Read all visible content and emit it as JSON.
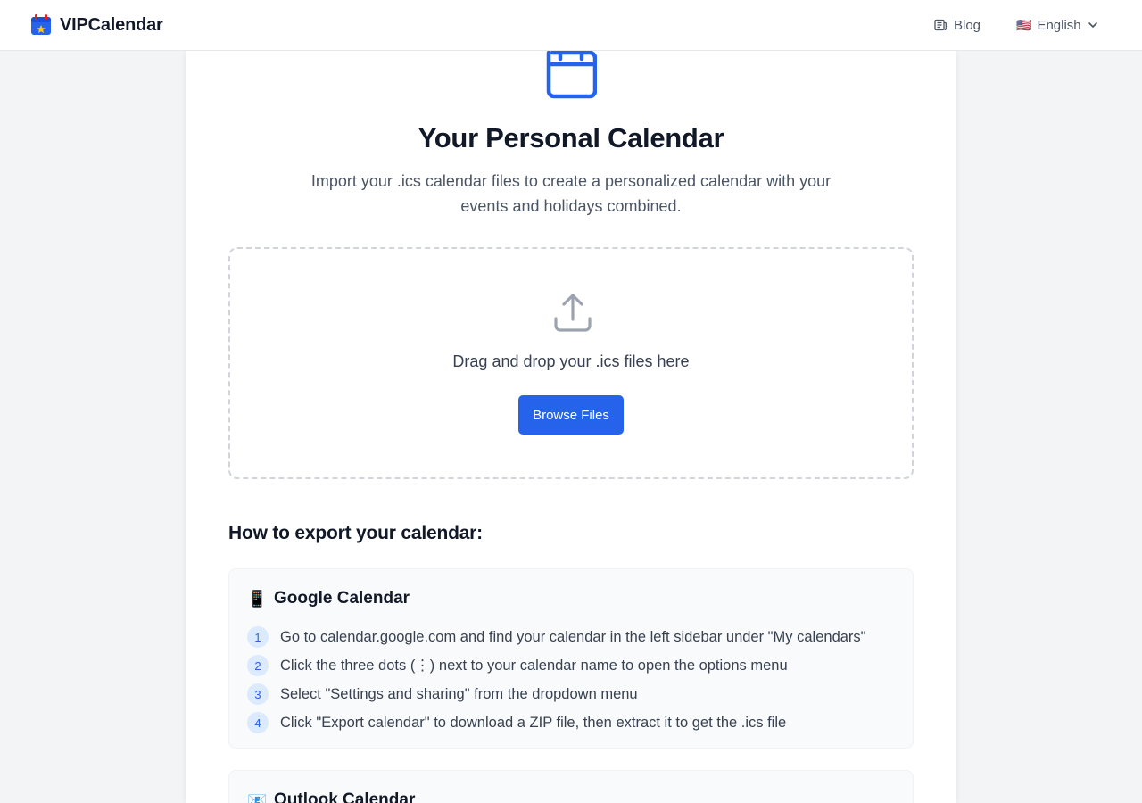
{
  "header": {
    "logo_text": "VIPCalendar",
    "nav": {
      "blog_label": "Blog",
      "language_label": "English",
      "language_flag": "🇺🇸"
    }
  },
  "hero": {
    "icon": "calendar-icon",
    "title": "Your Personal Calendar",
    "subtitle": "Import your .ics calendar files to create a personalized calendar with your events and holidays combined."
  },
  "upload": {
    "icon": "upload-icon",
    "drop_text": "Drag and drop your .ics files here",
    "browse_label": "Browse Files"
  },
  "export_guide": {
    "heading": "How to export your calendar:",
    "sections": [
      {
        "emoji": "📱",
        "name": "Google Calendar",
        "steps": [
          {
            "num": "1",
            "text": "Go to calendar.google.com and find your calendar in the left sidebar under \"My calendars\""
          },
          {
            "num": "2",
            "text": "Click the three dots (⋮) next to your calendar name to open the options menu"
          },
          {
            "num": "3",
            "text": "Select \"Settings and sharing\" from the dropdown menu"
          },
          {
            "num": "4",
            "text": "Click \"Export calendar\" to download a ZIP file, then extract it to get the .ics file"
          }
        ]
      },
      {
        "emoji": "📧",
        "name": "Outlook Calendar",
        "steps": []
      }
    ]
  },
  "colors": {
    "accent": "#2563eb",
    "step_badge_bg": "#dbeafe",
    "page_bg": "#f3f4f6"
  }
}
